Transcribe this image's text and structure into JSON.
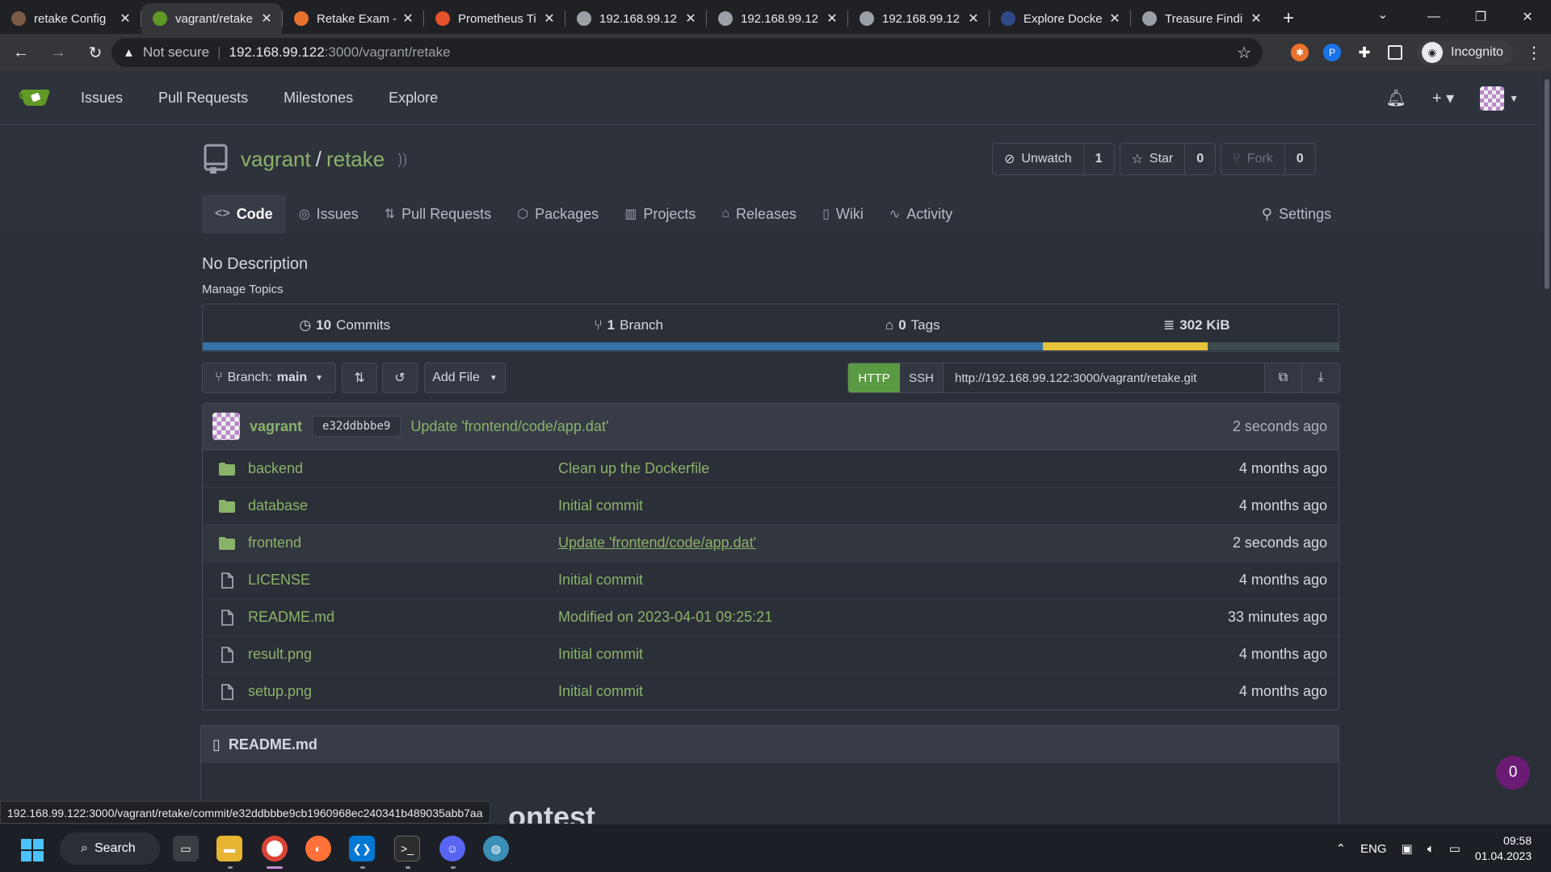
{
  "browser": {
    "tabs": [
      {
        "title": "retake Config",
        "favicon_color": "#7a5c46",
        "active": false
      },
      {
        "title": "vagrant/retake",
        "favicon_color": "#609926",
        "active": true
      },
      {
        "title": "Retake Exam -",
        "favicon_color": "#e8712d",
        "active": false
      },
      {
        "title": "Prometheus Ti",
        "favicon_color": "#e6522c",
        "active": false
      },
      {
        "title": "192.168.99.12",
        "favicon_color": "#9aa0a6",
        "active": false
      },
      {
        "title": "192.168.99.12",
        "favicon_color": "#9aa0a6",
        "active": false
      },
      {
        "title": "192.168.99.12",
        "favicon_color": "#9aa0a6",
        "active": false
      },
      {
        "title": "Explore Docke",
        "favicon_color": "#2e4a88",
        "active": false
      },
      {
        "title": "Treasure Findi",
        "favicon_color": "#9aa0a6",
        "active": false
      }
    ],
    "address": {
      "security": "Not secure",
      "host": "192.168.99.122",
      "path": ":3000/vagrant/retake"
    },
    "profile_label": "Incognito"
  },
  "gitea": {
    "nav": [
      "Issues",
      "Pull Requests",
      "Milestones",
      "Explore"
    ],
    "accent": "#609926"
  },
  "repo": {
    "owner": "vagrant",
    "name": "retake",
    "watch_label": "Unwatch",
    "watch_count": "1",
    "star_label": "Star",
    "star_count": "0",
    "fork_label": "Fork",
    "fork_count": "0",
    "tabs": [
      {
        "label": "Code",
        "icon": "code-icon",
        "glyph": "<>",
        "active": true
      },
      {
        "label": "Issues",
        "icon": "issue-icon",
        "glyph": "◎",
        "active": false
      },
      {
        "label": "Pull Requests",
        "icon": "pull-request-icon",
        "glyph": "⇅",
        "active": false
      },
      {
        "label": "Packages",
        "icon": "package-icon",
        "glyph": "⬡",
        "active": false
      },
      {
        "label": "Projects",
        "icon": "project-icon",
        "glyph": "▥",
        "active": false
      },
      {
        "label": "Releases",
        "icon": "tag-icon",
        "glyph": "⌂",
        "active": false
      },
      {
        "label": "Wiki",
        "icon": "book-icon",
        "glyph": "▯",
        "active": false
      },
      {
        "label": "Activity",
        "icon": "pulse-icon",
        "glyph": "∿",
        "active": false
      }
    ],
    "settings_label": "Settings",
    "description": "No Description",
    "manage_topics": "Manage Topics",
    "stats": {
      "commits_num": "10",
      "commits_label": "Commits",
      "branch_num": "1",
      "branch_label": "Branch",
      "tags_num": "0",
      "tags_label": "Tags",
      "size": "302 KiB"
    },
    "languages": [
      {
        "color": "#3572a5",
        "share": 0.74
      },
      {
        "color": "#e5c33b",
        "share": 0.145
      },
      {
        "color": "#3d4c4f",
        "share": 0.115
      }
    ],
    "branch_prefix": "Branch:",
    "branch_name": "main",
    "add_file": "Add File",
    "clone": {
      "http": "HTTP",
      "ssh": "SSH",
      "url": "http://192.168.99.122:3000/vagrant/retake.git"
    },
    "latest_commit": {
      "author": "vagrant",
      "sha": "e32ddbbbe9",
      "message": "Update 'frontend/code/app.dat'",
      "age": "2 seconds ago"
    },
    "files": [
      {
        "name": "backend",
        "type": "folder",
        "message": "Clean up the Dockerfile",
        "age": "4 months ago"
      },
      {
        "name": "database",
        "type": "folder",
        "message": "Initial commit",
        "age": "4 months ago"
      },
      {
        "name": "frontend",
        "type": "folder",
        "message": "Update 'frontend/code/app.dat'",
        "age": "2 seconds ago"
      },
      {
        "name": "LICENSE",
        "type": "file",
        "message": "Initial commit",
        "age": "4 months ago"
      },
      {
        "name": "README.md",
        "type": "file",
        "message": "Modified on 2023-04-01 09:25:21",
        "age": "33 minutes ago"
      },
      {
        "name": "result.png",
        "type": "file",
        "message": "Initial commit",
        "age": "4 months ago"
      },
      {
        "name": "setup.png",
        "type": "file",
        "message": "Initial commit",
        "age": "4 months ago"
      }
    ],
    "readme_title": "README.md",
    "readme_heading_partial": "ontest"
  },
  "status_url": "192.168.99.122:3000/vagrant/retake/commit/e32ddbbbe9cb1960968ec240341b489035abb7aa",
  "notification_badge": "0",
  "taskbar": {
    "search_label": "Search",
    "language": "ENG",
    "time": "09:58",
    "date": "01.04.2023"
  }
}
